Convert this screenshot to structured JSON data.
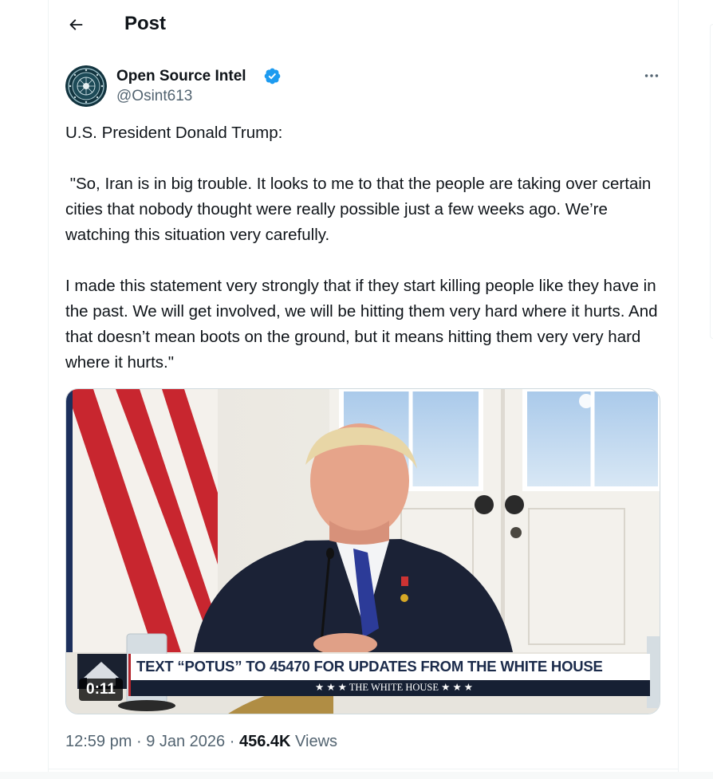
{
  "header": {
    "title": "Post"
  },
  "author": {
    "name": "Open Source Intel",
    "handle": "@Osint613",
    "verified_color": "#1d9bf0"
  },
  "tweet": {
    "text": "U.S. President Donald Trump:\n\n \"So, Iran is in big trouble. It looks to me to that the people are taking over certain cities that nobody thought were really possible just a few weeks ago. We’re watching this situation very carefully.\n\nI made this statement very strongly that if they start killing people like they have in the past. We will get involved, we will be hitting them very hard where it hurts. And that doesn’t mean boots on the ground, but it means hitting them very very hard where it hurts.\""
  },
  "media": {
    "duration": "0:11",
    "chyron": "TEXT “POTUS” TO 45470 FOR UPDATES FROM THE WHITE HOUSE",
    "chyron_sub": "★ ★ ★   THE WHITE HOUSE   ★ ★ ★"
  },
  "meta": {
    "time": "12:59 pm",
    "date": "9 Jan 2026",
    "separator": "·",
    "views_count": "456.4K",
    "views_label": "Views"
  },
  "icons": {
    "back": "arrow-left-icon",
    "more": "more-horizontal-icon",
    "verified": "verified-badge-icon"
  },
  "colors": {
    "text": "#0f1419",
    "secondary": "#536471",
    "accent": "#1d9bf0",
    "border": "#eff3f4"
  }
}
